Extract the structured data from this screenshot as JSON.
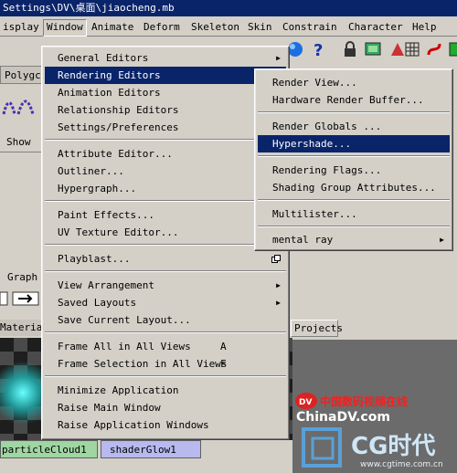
{
  "titlebar": {
    "text": "Settings\\DV\\桌面\\jiaocheng.mb"
  },
  "menubar": {
    "items": [
      "isplay",
      "Window",
      "Animate",
      "Deform",
      "Skeleton",
      "Skin",
      "Constrain",
      "Character",
      "Help"
    ]
  },
  "left": {
    "shelf_tab": "Polygc",
    "show_label": "Show",
    "graph_label": "Graph",
    "materials_label": "Materials"
  },
  "swatches": {
    "first": "particleCloud1",
    "second": "shaderGlow1"
  },
  "projects_tab": "Projects",
  "window_menu": {
    "items": [
      {
        "label": "General Editors",
        "submenu": true
      },
      {
        "label": "Rendering Editors",
        "submenu": true,
        "highlighted": true
      },
      {
        "label": "Animation Editors",
        "submenu": true
      },
      {
        "label": "Relationship Editors",
        "submenu": true
      },
      {
        "label": "Settings/Preferences",
        "submenu": true
      },
      {
        "label": "Attribute Editor..."
      },
      {
        "label": "Outliner..."
      },
      {
        "label": "Hypergraph..."
      },
      {
        "label": "Paint Effects..."
      },
      {
        "label": "UV Texture Editor..."
      },
      {
        "label": "Playblast..."
      },
      {
        "label": "View Arrangement",
        "submenu": true
      },
      {
        "label": "Saved Layouts",
        "submenu": true
      },
      {
        "label": "Save Current Layout..."
      },
      {
        "label": "Frame All in All Views",
        "shortcut": "A"
      },
      {
        "label": "Frame Selection in All Views",
        "shortcut": "F"
      },
      {
        "label": "Minimize Application"
      },
      {
        "label": "Raise Main Window"
      },
      {
        "label": "Raise Application Windows"
      }
    ]
  },
  "rendering_submenu": {
    "items": [
      {
        "label": "Render View..."
      },
      {
        "label": "Hardware Render Buffer..."
      },
      {
        "label": "Render Globals ..."
      },
      {
        "label": "Hypershade...",
        "highlighted": true
      },
      {
        "label": "Rendering Flags..."
      },
      {
        "label": "Shading Group Attributes..."
      },
      {
        "label": "Multilister..."
      },
      {
        "label": "mental ray",
        "submenu": true
      }
    ]
  },
  "watermark": {
    "cn": "中国数码视频在线",
    "site": "ChinaDV.com",
    "logo": "CG时代",
    "url": "www.cgtime.com.cn"
  },
  "icons": {
    "playblast_option": "option-box-icon",
    "help": "help-question-icon",
    "sphere": "blue-sphere-icon"
  }
}
